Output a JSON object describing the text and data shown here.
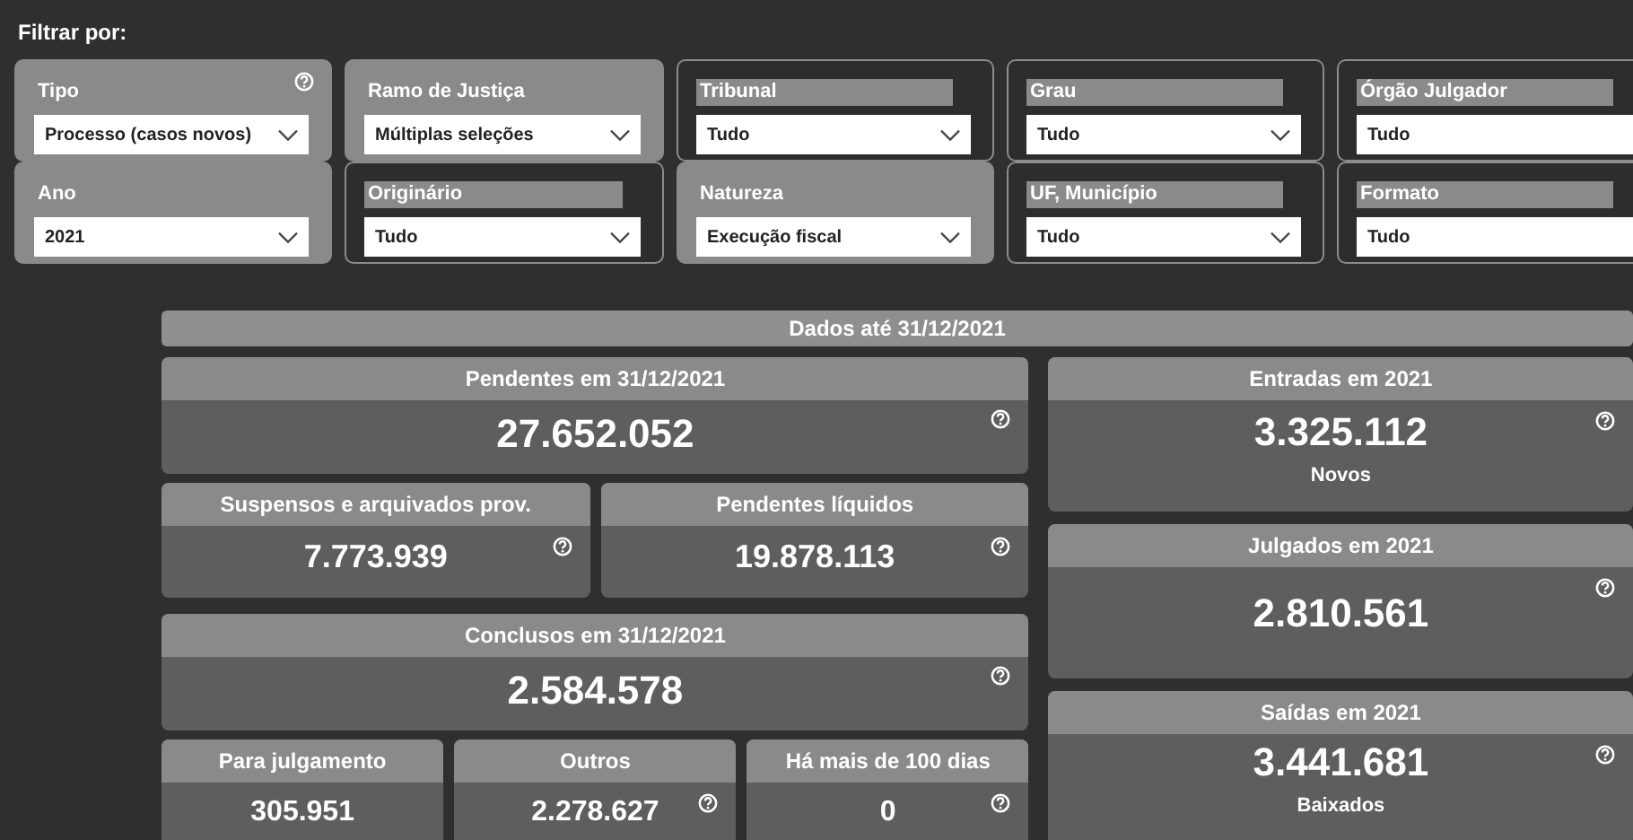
{
  "heading": "Filtrar por:",
  "filters": [
    {
      "label": "Tipo",
      "value": "Processo (casos novos)",
      "kind": "filled",
      "help": true,
      "chevron": true
    },
    {
      "label": "Ramo de Justiça",
      "value": "Múltiplas seleções",
      "kind": "filled",
      "help": false,
      "chevron": true
    },
    {
      "label": "Tribunal",
      "value": "Tudo",
      "kind": "outlined",
      "help": false,
      "chevron": true
    },
    {
      "label": "Grau",
      "value": "Tudo",
      "kind": "outlined",
      "help": false,
      "chevron": true
    },
    {
      "label": "Órgão Julgador",
      "value": "Tudo",
      "kind": "outlined",
      "help": false,
      "chevron": false
    },
    {
      "label": "Ano",
      "value": "2021",
      "kind": "filled",
      "help": false,
      "chevron": true
    },
    {
      "label": "Originário",
      "value": "Tudo",
      "kind": "outlined",
      "help": false,
      "chevron": true
    },
    {
      "label": "Natureza",
      "value": "Execução fiscal",
      "kind": "filled",
      "help": false,
      "chevron": true
    },
    {
      "label": "UF, Município",
      "value": "Tudo",
      "kind": "outlined",
      "help": false,
      "chevron": true
    },
    {
      "label": "Formato",
      "value": "Tudo",
      "kind": "outlined",
      "help": false,
      "chevron": false
    }
  ],
  "summary_title": "Dados até 31/12/2021",
  "left_rows": [
    {
      "cards": [
        {
          "title": "Pendentes em 31/12/2021",
          "value": "27.652.052",
          "help": true
        }
      ]
    },
    {
      "cards": [
        {
          "title": "Suspensos e arquivados prov.",
          "value": "7.773.939",
          "help": true
        },
        {
          "title": "Pendentes líquidos",
          "value": "19.878.113",
          "help": true
        }
      ]
    },
    {
      "cards": [
        {
          "title": "Conclusos em 31/12/2021",
          "value": "2.584.578",
          "help": true
        }
      ]
    },
    {
      "cards": [
        {
          "title": "Para julgamento",
          "value": "305.951",
          "help": false
        },
        {
          "title": "Outros",
          "value": "2.278.627",
          "help": true
        },
        {
          "title": "Há mais de 100 dias",
          "value": "0",
          "help": true
        }
      ]
    }
  ],
  "right_cards": [
    {
      "title": "Entradas em 2021",
      "value": "3.325.112",
      "subtitle": "Novos",
      "help": true
    },
    {
      "title": "Julgados em 2021",
      "value": "2.810.561",
      "help": true
    },
    {
      "title": "Saídas em 2021",
      "value": "3.441.681",
      "subtitle": "Baixados",
      "help": true
    }
  ]
}
